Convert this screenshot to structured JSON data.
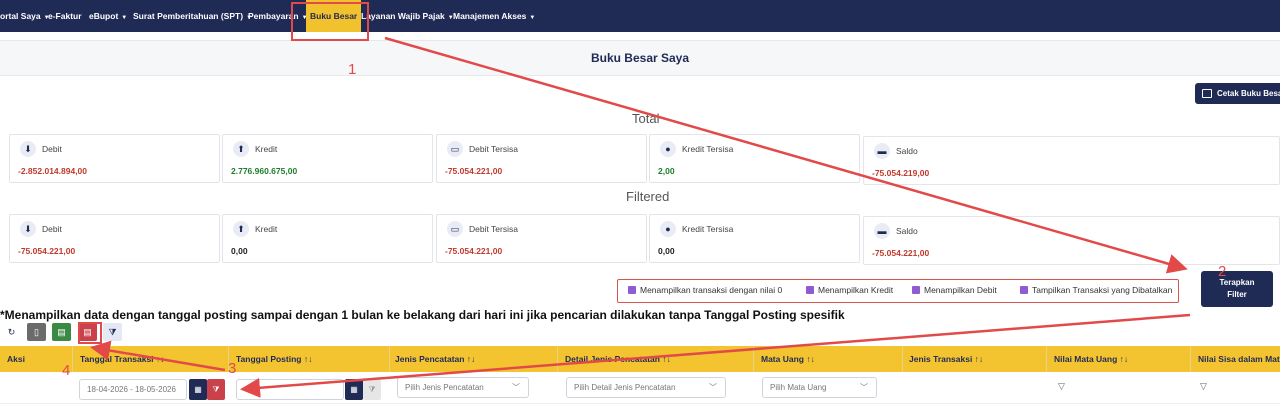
{
  "nav": {
    "items": [
      {
        "label": "ortal Saya",
        "caret": true
      },
      {
        "label": "e-Faktur",
        "caret": false
      },
      {
        "label": "eBupot",
        "caret": true
      },
      {
        "label": "Surat Pemberitahuan (SPT)",
        "caret": true
      },
      {
        "label": "Pembayaran",
        "caret": true
      },
      {
        "label": "Buku Besar",
        "caret": false,
        "active": true
      },
      {
        "label": "Layanan Wajib Pajak",
        "caret": true
      },
      {
        "label": "Manajemen Akses",
        "caret": true
      }
    ]
  },
  "page": {
    "title": "Buku Besar Saya",
    "print_label": "Cetak Buku Besar"
  },
  "total": {
    "label": "Total",
    "cards": [
      {
        "label": "Debit",
        "value": "-2.852.014.894,00",
        "icon": "hand-coin-icon"
      },
      {
        "label": "Kredit",
        "value": "2.776.960.675,00",
        "icon": "hand-money-icon"
      },
      {
        "label": "Debit Tersisa",
        "value": "-75.054.221,00",
        "icon": "cash-icon"
      },
      {
        "label": "Kredit Tersisa",
        "value": "2,00",
        "icon": "coins-icon"
      },
      {
        "label": "Saldo",
        "value": "-75.054.219,00",
        "icon": "wallet-icon"
      }
    ]
  },
  "filtered": {
    "label": "Filtered",
    "cards": [
      {
        "label": "Debit",
        "value": "-75.054.221,00",
        "icon": "hand-coin-icon"
      },
      {
        "label": "Kredit",
        "value": "0,00",
        "icon": "hand-money-icon"
      },
      {
        "label": "Debit Tersisa",
        "value": "-75.054.221,00",
        "icon": "cash-icon"
      },
      {
        "label": "Kredit Tersisa",
        "value": "0,00",
        "icon": "coins-icon"
      },
      {
        "label": "Saldo",
        "value": "-75.054.221,00",
        "icon": "wallet-icon"
      }
    ]
  },
  "checkboxes": [
    {
      "label": "Menampilkan transaksi dengan nilai 0",
      "checked": true
    },
    {
      "label": "Menampilkan Kredit",
      "checked": true
    },
    {
      "label": "Menampilkan Debit",
      "checked": true
    },
    {
      "label": "Tampilkan Transaksi yang Dibatalkan",
      "checked": true
    }
  ],
  "apply_button": {
    "line1": "Terapkan",
    "line2": "Filter"
  },
  "note": "*Menampilkan data dengan tanggal posting sampai dengan 1 bulan ke belakang dari hari ini jika pencarian dilakukan tanpa Tanggal Posting spesifik",
  "toolbar": {
    "buttons": [
      {
        "icon": "refresh-icon",
        "glyph": "↻"
      },
      {
        "icon": "file-icon",
        "glyph": "▯"
      },
      {
        "icon": "excel-icon",
        "glyph": "▤"
      },
      {
        "icon": "pdf-icon",
        "glyph": "▤"
      },
      {
        "icon": "filter-clear-icon",
        "glyph": "⧩"
      }
    ]
  },
  "table": {
    "headers": [
      "Aksi",
      "Tanggal Transaksi ↑↓",
      "Tanggal Posting ↑↓",
      "Jenis Pencatatan ↑↓",
      "Detail Jenis Pencatatan ↑↓",
      "Mata Uang ↑↓",
      "Jenis Transaksi ↑↓",
      "Nilai Mata Uang ↑↓",
      "Nilai Sisa dalam Mata"
    ],
    "filters": {
      "tanggal_transaksi": "18-04-2026 - 18-05-2026",
      "jenis_pencatatan_placeholder": "Pilih Jenis Pencatatan",
      "detail_jenis_placeholder": "Pilih Detail Jenis Pencatatan",
      "mata_uang_placeholder": "Pilih Mata Uang"
    }
  },
  "annotations": {
    "n1": "1",
    "n2": "2",
    "n3": "3",
    "n4": "4"
  },
  "colors": {
    "nav": "#1f2a55",
    "accent": "#f4c430",
    "negative": "#c0392b",
    "positive": "#1e7d2a",
    "annotation": "#e24a4a"
  }
}
